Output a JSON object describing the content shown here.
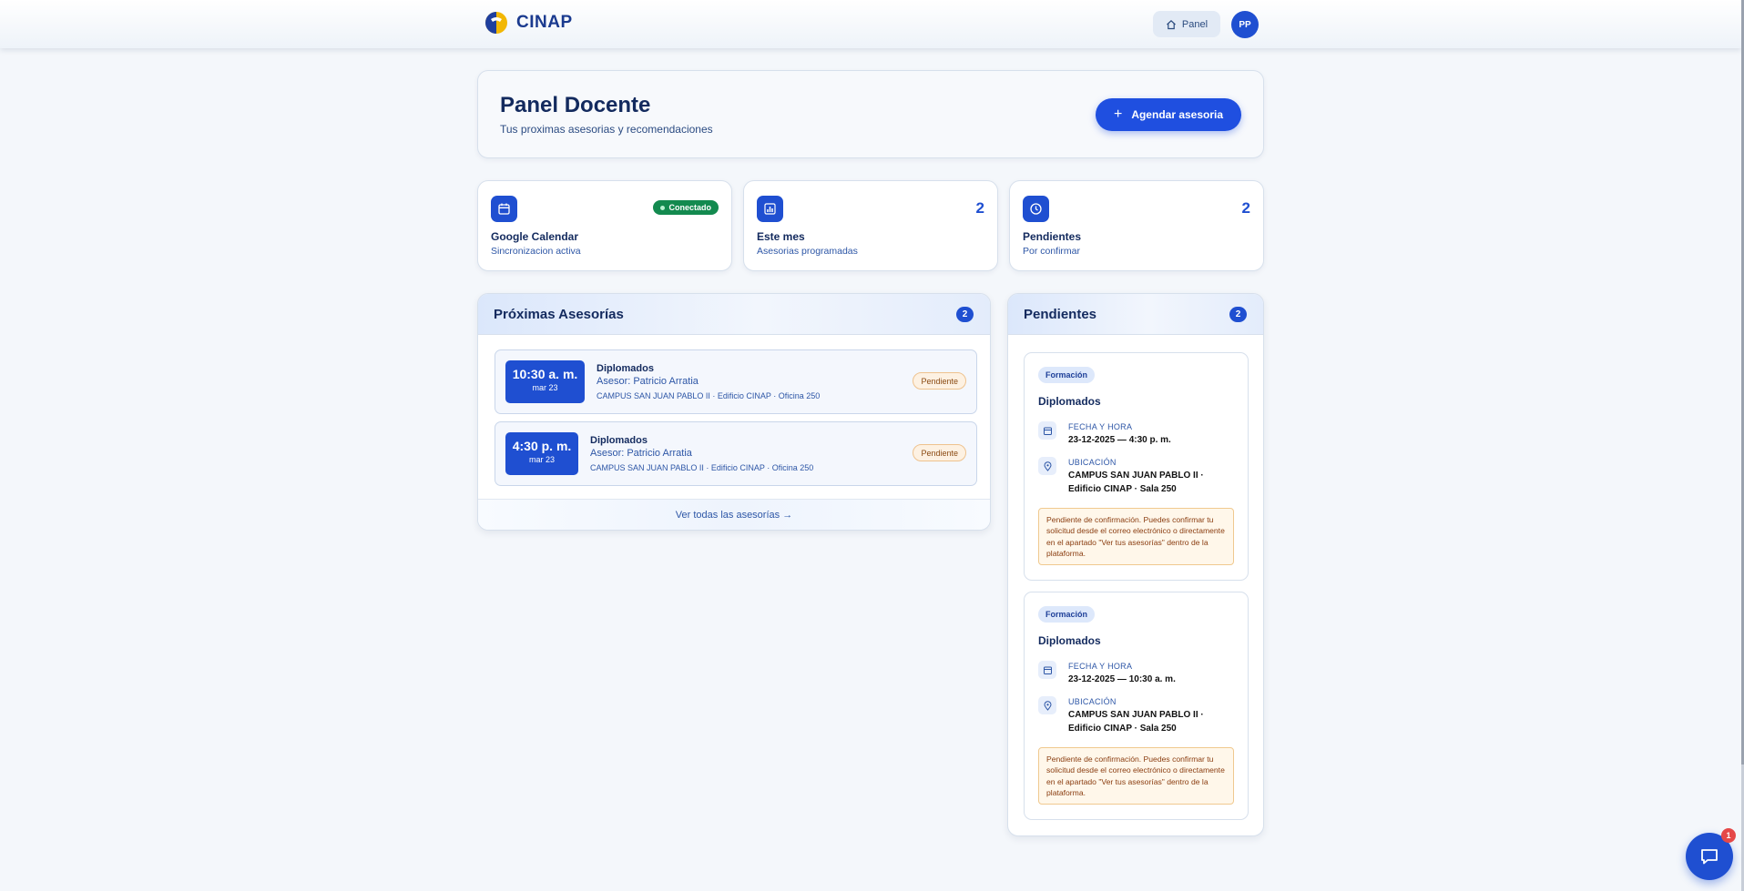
{
  "brand": {
    "name": "CINAP"
  },
  "nav": {
    "panel_label": "Panel",
    "avatar_initials": "PP"
  },
  "hero": {
    "title": "Panel Docente",
    "subtitle": "Tus proximas asesorias y recomendaciones",
    "cta_label": "Agendar asesoria"
  },
  "stats": [
    {
      "title": "Google Calendar",
      "subtitle": "Sincronizacion activa",
      "badge": "Conectado",
      "icon": "calendar-icon"
    },
    {
      "title": "Este mes",
      "subtitle": "Asesorias programadas",
      "value": "2",
      "icon": "bar-chart-icon"
    },
    {
      "title": "Pendientes",
      "subtitle": "Por confirmar",
      "value": "2",
      "icon": "clock-icon"
    }
  ],
  "upcoming": {
    "title": "Próximas Asesorías",
    "count": "2",
    "items": [
      {
        "time": "10:30 a. m.",
        "date": "mar 23",
        "title": "Diplomados",
        "advisor": "Asesor: Patricio Arratia",
        "location": "CAMPUS SAN JUAN PABLO II · Edificio CINAP · Oficina 250",
        "status": "Pendiente"
      },
      {
        "time": "4:30 p. m.",
        "date": "mar 23",
        "title": "Diplomados",
        "advisor": "Asesor: Patricio Arratia",
        "location": "CAMPUS SAN JUAN PABLO II · Edificio CINAP · Oficina 250",
        "status": "Pendiente"
      }
    ],
    "footer_link": "Ver todas las asesorías →"
  },
  "pending": {
    "title": "Pendientes",
    "count": "2",
    "items": [
      {
        "tag": "Formación",
        "title": "Diplomados",
        "date_label": "FECHA Y HORA",
        "date_value": "23-12-2025 — 4:30 p. m.",
        "loc_label": "UBICACIÓN",
        "loc_value": "CAMPUS SAN JUAN PABLO II · Edificio CINAP · Sala 250",
        "note": "Pendiente de confirmación. Puedes confirmar tu solicitud desde el correo electrónico o directamente en el apartado \"Ver tus asesorías\" dentro de la plataforma."
      },
      {
        "tag": "Formación",
        "title": "Diplomados",
        "date_label": "FECHA Y HORA",
        "date_value": "23-12-2025 — 10:30 a. m.",
        "loc_label": "UBICACIÓN",
        "loc_value": "CAMPUS SAN JUAN PABLO II · Edificio CINAP · Sala 250",
        "note": "Pendiente de confirmación. Puedes confirmar tu solicitud desde el correo electrónico o directamente en el apartado \"Ver tus asesorías\" dentro de la plataforma."
      }
    ]
  },
  "chat": {
    "badge": "1",
    "icon": "chat-icon"
  },
  "colors": {
    "primary": "#1f4fd1",
    "success": "#138a4f",
    "warning_bg": "#fff7ea",
    "danger": "#e54848"
  }
}
